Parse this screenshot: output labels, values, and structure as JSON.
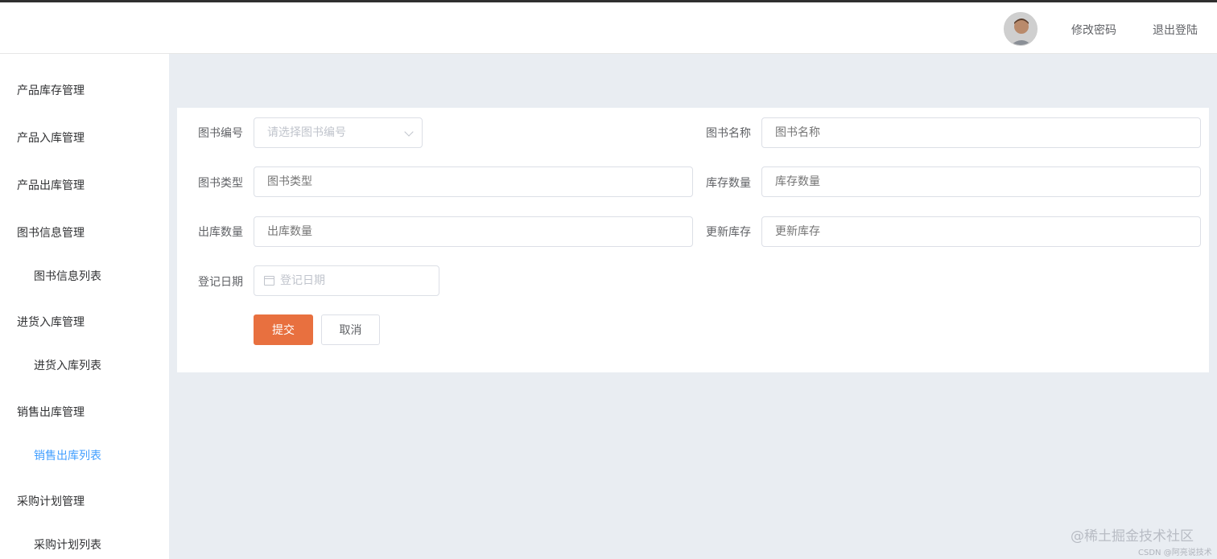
{
  "header": {
    "change_password": "修改密码",
    "logout": "退出登陆"
  },
  "sidebar": {
    "items": [
      {
        "label": "产品库存管理"
      },
      {
        "label": "产品入库管理"
      },
      {
        "label": "产品出库管理"
      },
      {
        "label": "图书信息管理"
      },
      {
        "label": "图书信息列表"
      },
      {
        "label": "进货入库管理"
      },
      {
        "label": "进货入库列表"
      },
      {
        "label": "销售出库管理"
      },
      {
        "label": "销售出库列表"
      },
      {
        "label": "采购计划管理"
      },
      {
        "label": "采购计划列表"
      }
    ]
  },
  "form": {
    "book_no_label": "图书编号",
    "book_no_placeholder": "请选择图书编号",
    "book_name_label": "图书名称",
    "book_name_placeholder": "图书名称",
    "book_type_label": "图书类型",
    "book_type_placeholder": "图书类型",
    "stock_qty_label": "库存数量",
    "stock_qty_placeholder": "库存数量",
    "out_qty_label": "出库数量",
    "out_qty_placeholder": "出库数量",
    "update_stock_label": "更新库存",
    "update_stock_placeholder": "更新库存",
    "reg_date_label": "登记日期",
    "reg_date_placeholder": "登记日期",
    "submit": "提交",
    "cancel": "取消"
  },
  "watermark": {
    "main": "@稀土掘金技术社区",
    "sub": "CSDN @阿亮说技术"
  },
  "colors": {
    "primary_button": "#e8703f",
    "active_menu": "#409eff"
  }
}
